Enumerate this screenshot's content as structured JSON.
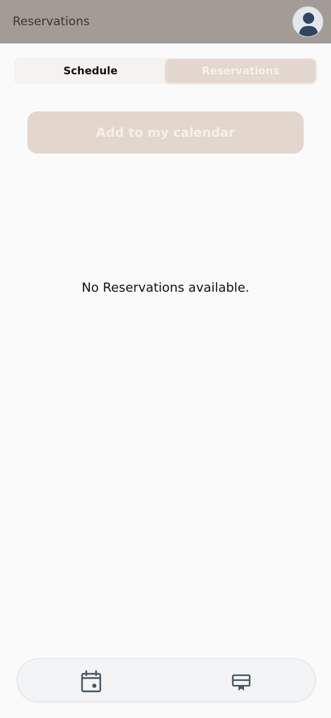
{
  "header": {
    "title": "Reservations",
    "avatar_icon": "user-avatar-icon"
  },
  "tabs": [
    {
      "label": "Schedule",
      "active": false
    },
    {
      "label": "Reservations",
      "active": true
    }
  ],
  "actions": {
    "add_calendar_label": "Add to my calendar"
  },
  "content": {
    "empty_message": "No Reservations available."
  },
  "bottom_nav": {
    "items": [
      {
        "icon": "calendar-icon"
      },
      {
        "icon": "ticket-icon"
      }
    ]
  },
  "colors": {
    "header_bg": "#a39c96",
    "accent": "#e3d6cd",
    "icon": "#4a5663"
  }
}
